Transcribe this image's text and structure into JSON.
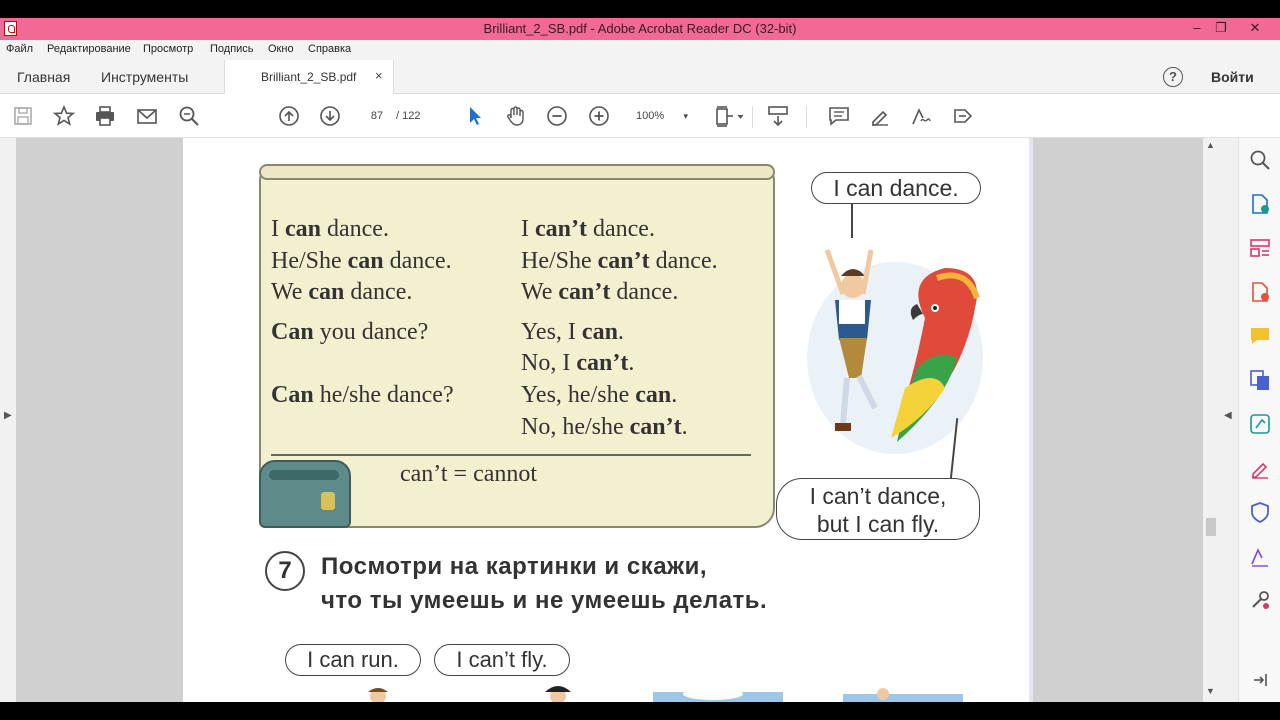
{
  "window": {
    "title": "Brilliant_2_SB.pdf - Adobe Acrobat Reader DC (32-bit)",
    "minimize": "–",
    "restore": "❐",
    "close": "✕"
  },
  "menu": {
    "items": [
      "Файл",
      "Редактирование",
      "Просмотр",
      "Подпись",
      "Окно",
      "Справка"
    ]
  },
  "tabs": {
    "home": "Главная",
    "tools": "Инструменты",
    "document": "Brilliant_2_SB.pdf",
    "close": "×",
    "help": "?",
    "signin": "Войти"
  },
  "toolbar": {
    "current_page": "87",
    "total_pages": "/ 122",
    "zoom": "100%",
    "zoom_caret": "▾"
  },
  "page": {
    "grammar_left": [
      {
        "bold": "I can",
        "rest": " dance."
      },
      {
        "bold": "",
        "pre": "He/She ",
        "mid": "can",
        "rest": " dance."
      },
      {
        "pre": "We ",
        "mid": "can",
        "rest": " dance."
      },
      {
        "mid": "Can",
        "rest": " you dance?"
      },
      {
        "mid": "Can",
        "rest": " he/she dance?"
      }
    ],
    "line1_left_a": "I ",
    "line1_left_b": "can",
    "line1_left_c": " dance.",
    "line2_left_a": "He/She ",
    "line2_left_b": "can",
    "line2_left_c": " dance.",
    "line3_left_a": "We ",
    "line3_left_b": "can",
    "line3_left_c": " dance.",
    "line4_left_b": "Can",
    "line4_left_c": " you dance?",
    "line5_left_b": "Can",
    "line5_left_c": " he/she dance?",
    "line1_right_a": "I ",
    "line1_right_b": "can’t",
    "line1_right_c": " dance.",
    "line2_right_a": "He/She ",
    "line2_right_b": "can’t",
    "line2_right_c": " dance.",
    "line3_right_a": "We ",
    "line3_right_b": "can’t",
    "line3_right_c": " dance.",
    "line4_right_a": "Yes, I ",
    "line4_right_b": "can",
    "line4_right_c": ".",
    "line4b_right_a": "No, I ",
    "line4b_right_b": "can’t",
    "line4b_right_c": ".",
    "line5_right_a": "Yes, he/she ",
    "line5_right_b": "can",
    "line5_right_c": ".",
    "line5b_right_a": "No, he/she ",
    "line5b_right_b": "can’t",
    "line5b_right_c": ".",
    "contraction": "can’t = cannot",
    "bubble_dance": "I can dance.",
    "bubble_fly_1": "I can’t dance,",
    "bubble_fly_2": "but I can fly.",
    "exercise_number": "7",
    "exercise_line1": "Посмотри на картинки и скажи,",
    "exercise_line2": "что ты умеешь и не умеешь делать.",
    "bubble_run": "I can run.",
    "bubble_cantfly": "I can’t fly."
  },
  "colors": {
    "titlebar": "#f06a95",
    "scroll_paper": "#f3f0cf",
    "select_tool": "#1a6fd1",
    "accent_icons": "#d23b6a"
  }
}
